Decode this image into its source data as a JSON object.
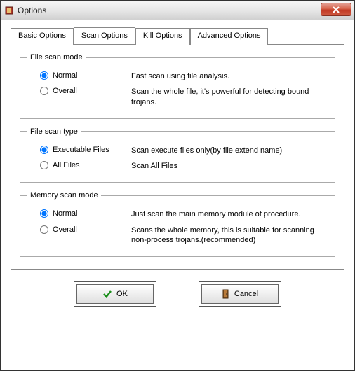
{
  "window": {
    "title": "Options"
  },
  "tabs": {
    "basic": "Basic Options",
    "scan": "Scan Options",
    "kill": "Kill Options",
    "advanced": "Advanced Options",
    "active": "scan"
  },
  "groups": {
    "file_scan_mode": {
      "legend": "File scan mode",
      "options": {
        "normal": {
          "label": "Normal",
          "desc": "Fast scan using file analysis."
        },
        "overall": {
          "label": "Overall",
          "desc": "Scan the whole file, it's powerful for detecting bound trojans."
        }
      },
      "selected": "normal"
    },
    "file_scan_type": {
      "legend": "File scan type",
      "options": {
        "exec": {
          "label": "Executable Files",
          "desc": "Scan execute files only(by file extend name)"
        },
        "all": {
          "label": "All Files",
          "desc": "Scan All Files"
        }
      },
      "selected": "exec"
    },
    "memory_scan_mode": {
      "legend": "Memory scan mode",
      "options": {
        "normal": {
          "label": "Normal",
          "desc": "Just scan the main memory module of procedure."
        },
        "overall": {
          "label": "Overall",
          "desc": "Scans the whole memory, this is suitable for scanning non-process trojans.(recommended)"
        }
      },
      "selected": "normal"
    }
  },
  "buttons": {
    "ok": "OK",
    "cancel": "Cancel"
  }
}
